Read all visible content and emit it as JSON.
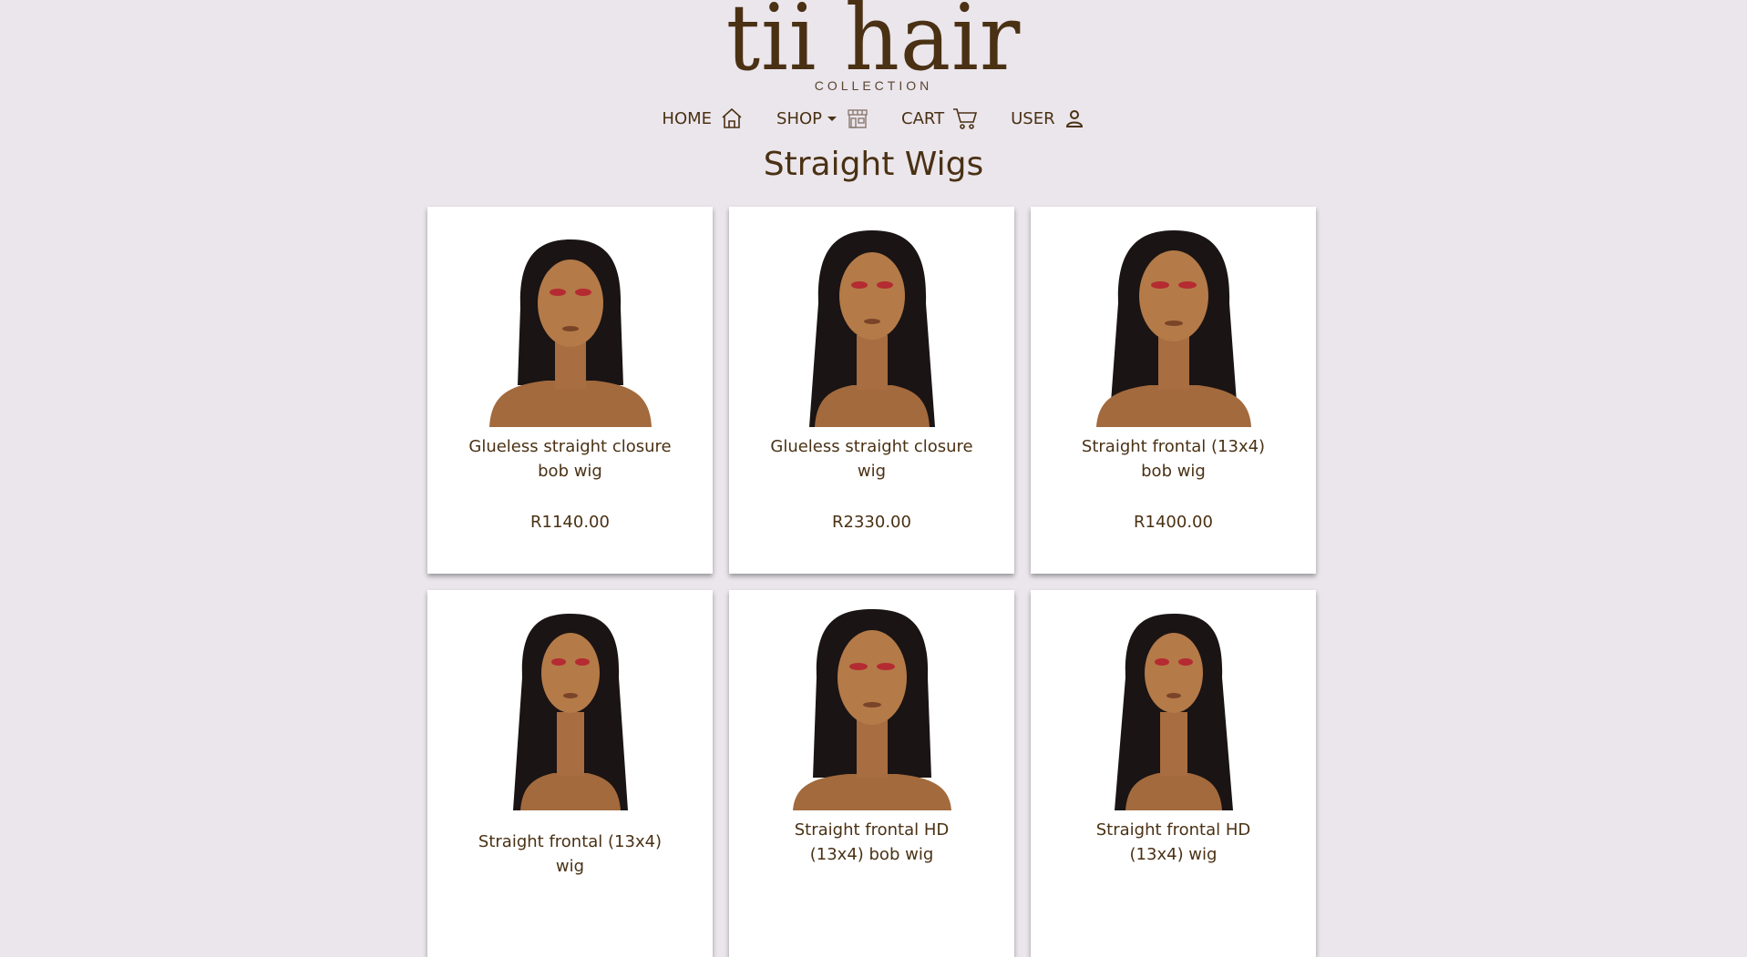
{
  "brand": {
    "logo_text": "tii hair",
    "logo_subtitle": "COLLECTION"
  },
  "nav": {
    "items": [
      {
        "label": "HOME",
        "icon": "home-icon"
      },
      {
        "label": "SHOP",
        "icon": "store-icon",
        "dropdown": true
      },
      {
        "label": "CART",
        "icon": "cart-icon"
      },
      {
        "label": "USER",
        "icon": "user-icon"
      }
    ]
  },
  "page": {
    "title": "Straight Wigs"
  },
  "products": [
    {
      "name": "Glueless straight closure bob wig",
      "price": "R1140.00",
      "image": "wig-short-bob"
    },
    {
      "name": "Glueless straight closure wig",
      "price": "R2330.00",
      "image": "wig-long"
    },
    {
      "name": "Straight frontal (13x4) bob wig",
      "price": "R1400.00",
      "image": "wig-long"
    },
    {
      "name": "Straight frontal (13x4) wig",
      "price": "",
      "image": "wig-long"
    },
    {
      "name": "Straight frontal HD (13x4) bob wig",
      "price": "",
      "image": "wig-bob"
    },
    {
      "name": "Straight frontal HD (13x4) wig",
      "price": "",
      "image": "wig-long"
    }
  ],
  "colors": {
    "background": "#ebe6ec",
    "brand_brown": "#4a3114",
    "card_bg": "#ffffff"
  }
}
